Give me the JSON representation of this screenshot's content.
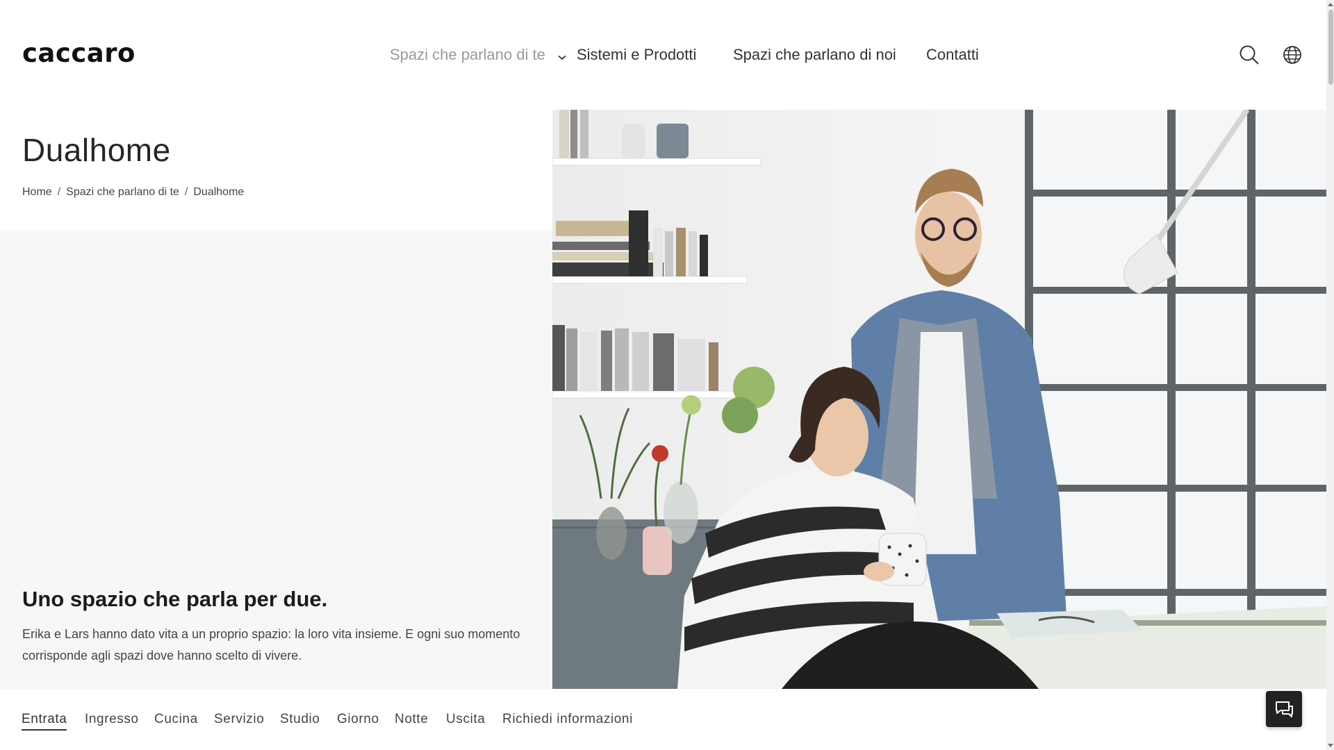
{
  "header": {
    "logo": "caccaro",
    "nav": [
      {
        "label": "Spazi che parlano di te",
        "active": true,
        "has_dropdown": true
      },
      {
        "label": "Sistemi e Prodotti"
      },
      {
        "label": "Spazi che parlano di noi"
      },
      {
        "label": "Contatti"
      }
    ],
    "icons": [
      "search-icon",
      "globe-icon"
    ]
  },
  "page": {
    "title": "Dualhome",
    "breadcrumb": [
      "Home",
      "Spazi che parlano di te",
      "Dualhome"
    ],
    "subtitle": "Uno spazio che parla per due.",
    "intro": "Erika e Lars hanno dato vita a un proprio spazio: la loro vita insieme. E ogni suo momento corrisponde agli spazi dove hanno scelto di vivere."
  },
  "tabs": [
    {
      "label": "Entrata",
      "active": true
    },
    {
      "label": "Ingresso"
    },
    {
      "label": "Cucina"
    },
    {
      "label": "Servizio"
    },
    {
      "label": "Studio"
    },
    {
      "label": "Giorno"
    },
    {
      "label": "Notte"
    },
    {
      "label": "Uscita"
    },
    {
      "label": "Richiedi informazioni"
    }
  ],
  "chat_button": {
    "icon": "chat-icon"
  },
  "colors": {
    "panel_grey": "#f7f7f7",
    "text_dark": "#1b1b1b",
    "nav_active": "#9a9a9a"
  }
}
